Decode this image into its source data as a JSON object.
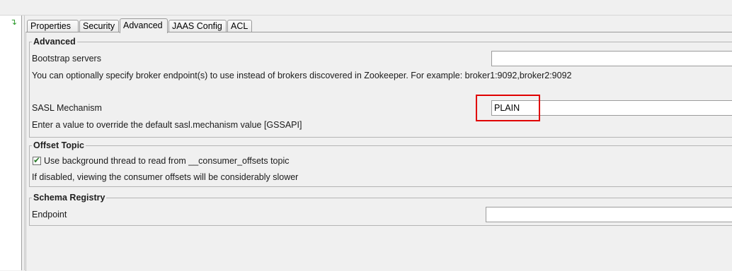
{
  "tabs": [
    "Properties",
    "Security",
    "Advanced",
    "JAAS Config",
    "ACL"
  ],
  "active_tab": "Advanced",
  "advanced": {
    "title": "Advanced",
    "bootstrap_label": "Bootstrap servers",
    "bootstrap_value": "",
    "bootstrap_help": "You can optionally specify broker endpoint(s) to use instead of brokers discovered in Zookeeper. For example: broker1:9092,broker2:9092",
    "sasl_label": "SASL Mechanism",
    "sasl_value": "PLAIN",
    "sasl_help": "Enter a value to override the default sasl.mechanism value [GSSAPI]"
  },
  "offset_topic": {
    "title": "Offset Topic",
    "checkbox_label": "Use background thread to read from __consumer_offsets topic",
    "checked": true,
    "help": "If disabled, viewing the consumer offsets will be considerably slower"
  },
  "schema_registry": {
    "title": "Schema Registry",
    "endpoint_label": "Endpoint",
    "endpoint_value": ""
  },
  "colors": {
    "highlight": "#e00000",
    "check": "#2a7a2a"
  }
}
